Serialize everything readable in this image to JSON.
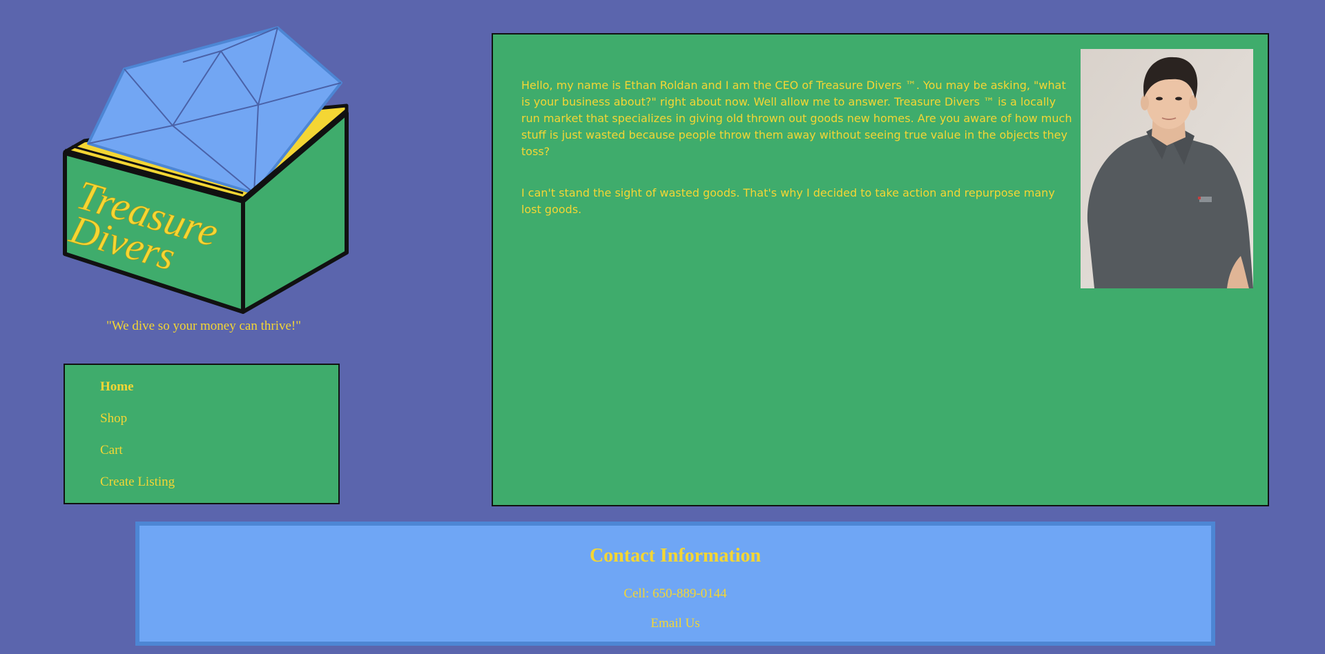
{
  "brand": {
    "logo_text_line1": "Treasure",
    "logo_text_line2": "Divers",
    "tagline": "\"We dive so your money can thrive!\""
  },
  "nav": {
    "items": [
      {
        "label": "Home",
        "active": true
      },
      {
        "label": "Shop",
        "active": false
      },
      {
        "label": "Cart",
        "active": false
      },
      {
        "label": "Create Listing",
        "active": false
      }
    ]
  },
  "main": {
    "paragraphs": [
      "Hello, my name is Ethan Roldan and I am the CEO of Treasure Divers ™. You may be asking, \"what is your business about?\" right about now. Well allow me to answer. Treasure Divers ™ is a locally run market that specializes in giving old thrown out goods new homes. Are you aware of how much stuff is just wasted because people throw them away without seeing true value in the objects they toss?",
      "I can't stand the sight of wasted goods. That's why I decided to take action and repurpose many lost goods."
    ]
  },
  "contact": {
    "title": "Contact Information",
    "cell": "Cell: 650-889-0144",
    "email_label": "Email Us"
  },
  "colors": {
    "background": "#5b65ad",
    "panel_green": "#3fac6c",
    "text_yellow": "#f4d634",
    "footer_blue": "#6fa6f5",
    "footer_border": "#4d86d4"
  }
}
